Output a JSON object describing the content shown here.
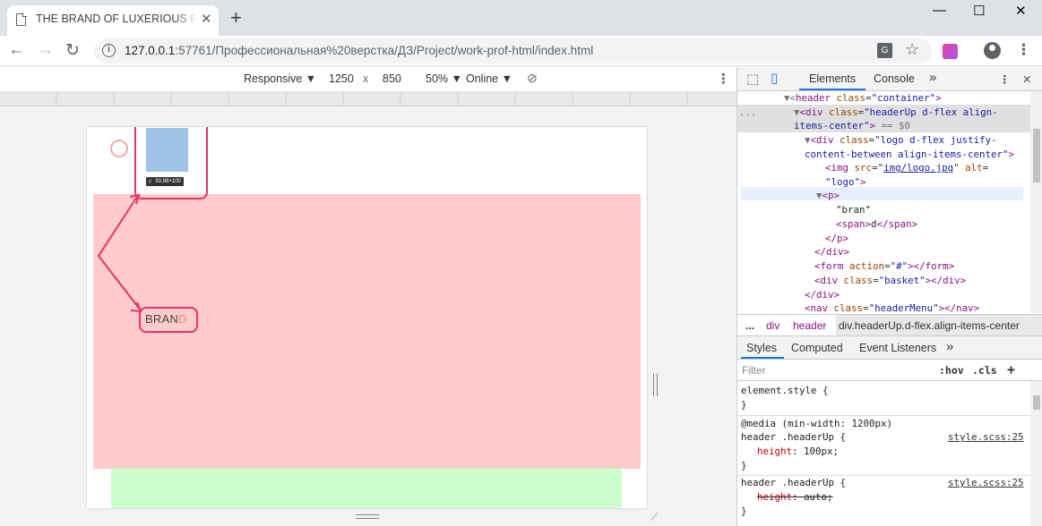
{
  "browser": {
    "tab_title": "THE BRAND OF LUXERIOUS FASHION",
    "new_tab": "+",
    "tab_close": "✕",
    "window_min": "—",
    "window_max": "☐",
    "window_close": "✕",
    "url_host": "127.0.0.1",
    "url_rest": ":57761/Профессиональная%20верстка/ДЗ/Project/work-prof-html/index.html"
  },
  "device_toolbar": {
    "mode": "Responsive ▼",
    "width": "1250",
    "times": "x",
    "height": "850",
    "zoom": "50% ▼",
    "network": "Online ▼"
  },
  "page": {
    "tooltip_tag": "p",
    "tooltip_size": "93.98×100",
    "brand_main": "BRAN",
    "brand_letter": "D"
  },
  "devtools": {
    "tabs": [
      "Elements",
      "Console",
      "»"
    ],
    "dom": {
      "l0_open": "▼<",
      "l0_tag": "header",
      "l0_attr": "class",
      "l0_val": "\"container\"",
      "l1_dots": "...",
      "l1_tag": "div",
      "l1_attr": "class",
      "l1_val_a": "\"headerUp d-flex align-",
      "l1_val_b": "items-center\"",
      "l1_eq": "== $0",
      "l2_tag": "div",
      "l2_attr": "class",
      "l2_val_a": "\"logo d-flex justify-",
      "l2_val_b": "content-between align-items-center\"",
      "l3_tag": "img",
      "l3_attr1": "src",
      "l3_val1": "img/logo.jpg",
      "l3_attr2": "alt",
      "l3_val2": "\"logo\"",
      "l4_tag": "p",
      "l5_text": "\"bran\"",
      "l6_tag": "span",
      "l6_text": "d",
      "l7_close": "</p>",
      "l8_close": "</div>",
      "l9_tag": "form",
      "l9_attr": "action",
      "l9_val": "\"#\"",
      "l10_tag": "div",
      "l10_attr": "class",
      "l10_val": "\"basket\"",
      "l11_close": "</div>",
      "l12_tag": "nav",
      "l12_attr": "class",
      "l12_val": "\"headerMenu\""
    },
    "breadcrumb": [
      "...",
      "div",
      "header",
      "div.headerUp.d-flex.align-items-center"
    ],
    "styles_tabs": [
      "Styles",
      "Computed",
      "Event Listeners",
      "»"
    ],
    "filter_placeholder": "Filter",
    "hov": ":hov",
    "cls": ".cls",
    "plus": "+",
    "rules": {
      "element_style": "element.style {",
      "close": "}",
      "media": "@media (min-width: 1200px)",
      "sel1": "header .headerUp {",
      "src1": "style.scss:25",
      "prop1": "height",
      "val1": "100px;",
      "sel2": "header .headerUp {",
      "src2": "style.scss:25",
      "prop2": "height",
      "val2": "auto;"
    }
  }
}
